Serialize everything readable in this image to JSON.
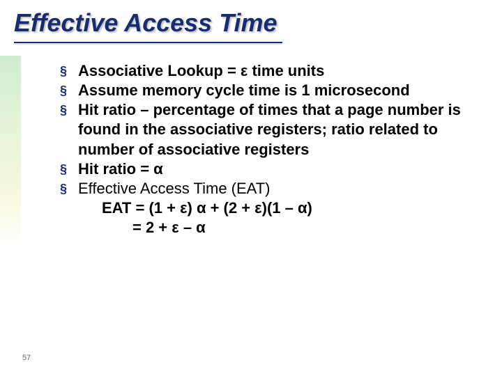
{
  "title": "Effective Access Time",
  "pageNumber": "57",
  "bullets": {
    "b1": "Associative Lookup = ε time units",
    "b2": "Assume memory cycle time is 1 microsecond",
    "b3": "Hit ratio – percentage of times that a page number is found in the associative registers; ratio related to number of associative registers",
    "b4": "Hit ratio = α",
    "b5": "Effective Access Time (EAT)",
    "eq1": "EAT = (1 + ε) α + (2 + ε)(1 – α)",
    "eq2": "= 2 + ε – α"
  }
}
